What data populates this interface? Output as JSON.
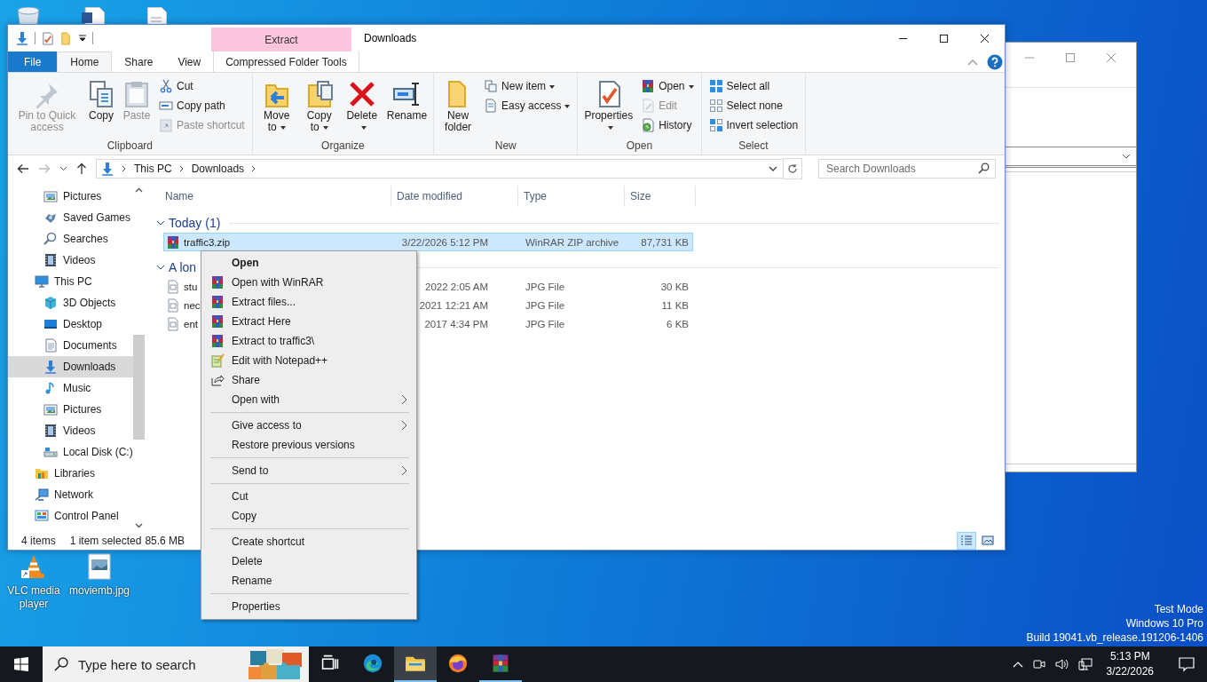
{
  "desktop": {
    "top_icons": [
      {
        "kind": "recycle"
      },
      {
        "kind": "doc"
      },
      {
        "kind": "file"
      }
    ],
    "icons": [
      {
        "label": "VLC media player",
        "kind": "vlc"
      },
      {
        "label": "moviemb.jpg",
        "kind": "image"
      }
    ],
    "system_notice": [
      "Test Mode",
      "Windows 10 Pro",
      "Build 19041.vb_release.191206-1406"
    ]
  },
  "explorer": {
    "context_tab": "Extract",
    "title": "Downloads",
    "tabs": [
      {
        "label": "File",
        "kind": "file",
        "selected": false
      },
      {
        "label": "Home",
        "kind": "tab",
        "selected": true
      },
      {
        "label": "Share",
        "kind": "tab",
        "selected": false
      },
      {
        "label": "View",
        "kind": "tab",
        "selected": false
      },
      {
        "label": "Compressed Folder Tools",
        "kind": "context",
        "selected": false
      }
    ],
    "ribbon_groups": [
      {
        "label": "Clipboard",
        "items": [
          {
            "label": "Pin to Quick access",
            "kind": "pin",
            "disabled": true,
            "dropdown": false
          },
          {
            "label": "Copy",
            "kind": "copy",
            "disabled": false,
            "dropdown": false
          },
          {
            "label": "Paste",
            "kind": "paste",
            "disabled": true,
            "dropdown": false
          },
          {
            "label": "Cut",
            "kind": "cut",
            "disabled": false,
            "dropdown": false
          },
          {
            "label": "Copy path",
            "kind": "copypath",
            "disabled": false,
            "dropdown": false
          },
          {
            "label": "Paste shortcut",
            "kind": "pasteshortcut",
            "disabled": true,
            "dropdown": false
          }
        ]
      },
      {
        "label": "Organize",
        "items": [
          {
            "label": "Move to",
            "kind": "move",
            "disabled": false,
            "dropdown": true
          },
          {
            "label": "Copy to",
            "kind": "copyto",
            "disabled": false,
            "dropdown": true
          },
          {
            "label": "Delete",
            "kind": "delete",
            "disabled": false,
            "dropdown": true
          },
          {
            "label": "Rename",
            "kind": "rename",
            "disabled": false,
            "dropdown": false
          }
        ]
      },
      {
        "label": "New",
        "items": [
          {
            "label": "New folder",
            "kind": "newfolder",
            "disabled": false,
            "dropdown": false
          },
          {
            "label": "New item",
            "kind": "newitem",
            "disabled": false,
            "dropdown": true
          },
          {
            "label": "Easy access",
            "kind": "easyaccess",
            "disabled": false,
            "dropdown": true
          }
        ]
      },
      {
        "label": "Open",
        "items": [
          {
            "label": "Properties",
            "kind": "properties",
            "disabled": false,
            "dropdown": true
          },
          {
            "label": "Open",
            "kind": "winrar",
            "disabled": false,
            "dropdown": true
          },
          {
            "label": "Edit",
            "kind": "edit",
            "disabled": true,
            "dropdown": false
          },
          {
            "label": "History",
            "kind": "history",
            "disabled": false,
            "dropdown": false
          }
        ]
      },
      {
        "label": "Select",
        "items": [
          {
            "label": "Select all",
            "kind": "selectall",
            "disabled": false,
            "dropdown": false
          },
          {
            "label": "Select none",
            "kind": "selectnone",
            "disabled": false,
            "dropdown": false
          },
          {
            "label": "Invert selection",
            "kind": "invert",
            "disabled": false,
            "dropdown": false
          }
        ]
      }
    ],
    "address": [
      "This PC",
      "Downloads"
    ],
    "search": {
      "placeholder": "Search Downloads"
    },
    "nav": [
      {
        "children": [
          {
            "label": "Pictures",
            "kind": "pictures",
            "selected": false
          },
          {
            "label": "Saved Games",
            "kind": "games",
            "selected": false
          },
          {
            "label": "Searches",
            "kind": "search",
            "selected": false
          },
          {
            "label": "Videos",
            "kind": "videos",
            "selected": false
          }
        ]
      },
      {
        "label": "This PC",
        "kind": "pc",
        "selected": false,
        "children": [
          {
            "label": "3D Objects",
            "kind": "cube",
            "selected": false
          },
          {
            "label": "Desktop",
            "kind": "desktop",
            "selected": false
          },
          {
            "label": "Documents",
            "kind": "documents",
            "selected": false
          },
          {
            "label": "Downloads",
            "kind": "downloads",
            "selected": true
          },
          {
            "label": "Music",
            "kind": "music",
            "selected": false
          },
          {
            "label": "Pictures",
            "kind": "pictures",
            "selected": false
          },
          {
            "label": "Videos",
            "kind": "videos",
            "selected": false
          },
          {
            "label": "Local Disk (C:)",
            "kind": "disk",
            "selected": false
          }
        ]
      },
      {
        "label": "Libraries",
        "kind": "libraries",
        "selected": false
      },
      {
        "label": "Network",
        "kind": "network",
        "selected": false
      },
      {
        "label": "Control Panel",
        "kind": "control",
        "selected": false
      }
    ],
    "columns": [
      "Name",
      "Date modified",
      "Type",
      "Size"
    ],
    "groups": [
      {
        "label": "Today (1)",
        "expanded": true,
        "rows": [
          {
            "name": "traffic3.zip",
            "date": "3/22/2026 5:12 PM",
            "type": "WinRAR ZIP archive",
            "size": "87,731 KB",
            "kind": "winrar",
            "selected": true
          }
        ]
      },
      {
        "label": "A lon",
        "expanded": true,
        "rows": [
          {
            "name": "stu",
            "date": "2022 2:05 AM",
            "type": "JPG File",
            "size": "30 KB",
            "kind": "jpg",
            "selected": false
          },
          {
            "name": "nec",
            "date": "2021 12:21 AM",
            "type": "JPG File",
            "size": "11 KB",
            "kind": "jpg",
            "selected": false
          },
          {
            "name": "ent",
            "date": "2017 4:34 PM",
            "type": "JPG File",
            "size": "6 KB",
            "kind": "jpg",
            "selected": false
          }
        ]
      }
    ],
    "status": {
      "count": "4 items",
      "selection": "1 item selected",
      "size": "85.6 MB"
    },
    "views": [
      {
        "kind": "details",
        "selected": true
      },
      {
        "kind": "tiles",
        "selected": false
      }
    ]
  },
  "context_menu": [
    {
      "kind": "plain",
      "label": "Open",
      "default": true,
      "submenu": false
    },
    {
      "kind": "winrar",
      "label": "Open with WinRAR",
      "default": false,
      "submenu": false
    },
    {
      "kind": "winrar",
      "label": "Extract files...",
      "default": false,
      "submenu": false
    },
    {
      "kind": "winrar",
      "label": "Extract Here",
      "default": false,
      "submenu": false
    },
    {
      "kind": "winrar",
      "label": "Extract to traffic3\\",
      "default": false,
      "submenu": false
    },
    {
      "kind": "notepad",
      "label": "Edit with Notepad++",
      "default": false,
      "submenu": false
    },
    {
      "kind": "share",
      "label": "Share",
      "default": false,
      "submenu": false
    },
    {
      "kind": "plain",
      "label": "Open with",
      "default": false,
      "submenu": true
    },
    {
      "kind": "separator"
    },
    {
      "kind": "plain",
      "label": "Give access to",
      "default": false,
      "submenu": true
    },
    {
      "kind": "plain",
      "label": "Restore previous versions",
      "default": false,
      "submenu": false
    },
    {
      "kind": "separator"
    },
    {
      "kind": "plain",
      "label": "Send to",
      "default": false,
      "submenu": true
    },
    {
      "kind": "separator"
    },
    {
      "kind": "plain",
      "label": "Cut",
      "default": false,
      "submenu": false
    },
    {
      "kind": "plain",
      "label": "Copy",
      "default": false,
      "submenu": false
    },
    {
      "kind": "separator"
    },
    {
      "kind": "plain",
      "label": "Create shortcut",
      "default": false,
      "submenu": false
    },
    {
      "kind": "plain",
      "label": "Delete",
      "default": false,
      "submenu": false
    },
    {
      "kind": "plain",
      "label": "Rename",
      "default": false,
      "submenu": false
    },
    {
      "kind": "separator"
    },
    {
      "kind": "plain",
      "label": "Properties",
      "default": false,
      "submenu": false
    }
  ],
  "taskbar": {
    "search_placeholder": "Type here to search",
    "apps": [
      {
        "kind": "taskview",
        "active": false,
        "running": false
      },
      {
        "kind": "edge",
        "active": false,
        "running": false
      },
      {
        "kind": "explorer",
        "active": true,
        "running": true
      },
      {
        "kind": "firefox",
        "active": false,
        "running": false
      },
      {
        "kind": "winrar",
        "active": false,
        "running": true
      }
    ],
    "clock": {
      "time": "5:13 PM",
      "date": "3/22/2026"
    }
  }
}
